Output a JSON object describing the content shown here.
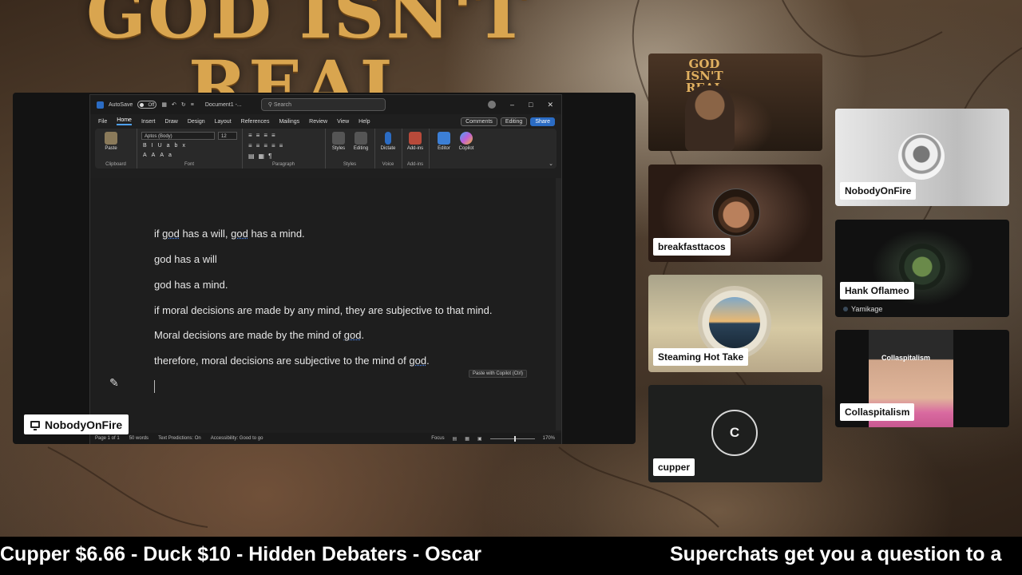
{
  "background": {
    "poster_title_line1": "GOD ISN'T",
    "poster_title_line2": "REAL"
  },
  "screenshare": {
    "presenter_name": "NobodyOnFire",
    "word": {
      "autosave_label": "AutoSave",
      "autosave_state": "Off",
      "doc_title": "Document1 -...",
      "search_placeholder": "Search",
      "menu": [
        "File",
        "Home",
        "Insert",
        "Draw",
        "Design",
        "Layout",
        "References",
        "Mailings",
        "Review",
        "View",
        "Help"
      ],
      "comments_label": "Comments",
      "editing_label": "Editing",
      "share_label": "Share",
      "ribbon": {
        "paste_label": "Paste",
        "font_name": "Aptos (Body)",
        "font_size": "12",
        "styles_label": "Styles",
        "editing_btn_label": "Editing",
        "dictate_label": "Dictate",
        "addins_label": "Add-ins",
        "editor_label": "Editor",
        "copilot_label": "Copilot",
        "groups": {
          "clipboard": "Clipboard",
          "font": "Font",
          "paragraph": "Paragraph",
          "styles": "Styles",
          "voice": "Voice",
          "addins": "Add-ins"
        }
      },
      "document_lines": [
        "if god has a will, god has a mind.",
        "god has a will",
        "god has a mind.",
        "if moral decisions are made by any mind, they are subjective to that mind.",
        "Moral decisions are made by the mind of god.",
        "therefore, moral decisions are subjective to the mind of god."
      ],
      "paste_copilot_label": "Paste with Copilot (Ctrl)",
      "status": {
        "page": "Page 1 of 1",
        "words": "50 words",
        "text_predictions": "Text Predictions: On",
        "accessibility": "Accessibility: Good to go",
        "focus": "Focus",
        "zoom": "170%"
      }
    }
  },
  "participants": [
    {
      "name": "",
      "kind": "poster",
      "poster_text": "GOD ISN'T REAL"
    },
    {
      "name": "breakfasttacos"
    },
    {
      "name": "Steaming Hot Take"
    },
    {
      "name": "cupper",
      "initial": "C"
    },
    {
      "name": "NobodyOnFire"
    },
    {
      "name": "Hank Oflameo",
      "sub": "Yamikage"
    },
    {
      "name": "Collaspitalism",
      "overlay_text": "Collaspitalism"
    }
  ],
  "ticker": {
    "left_text": "Cupper $6.66 - Duck $10 - Hidden Debaters - Oscar",
    "right_text": "Superchats get you a question to a"
  }
}
